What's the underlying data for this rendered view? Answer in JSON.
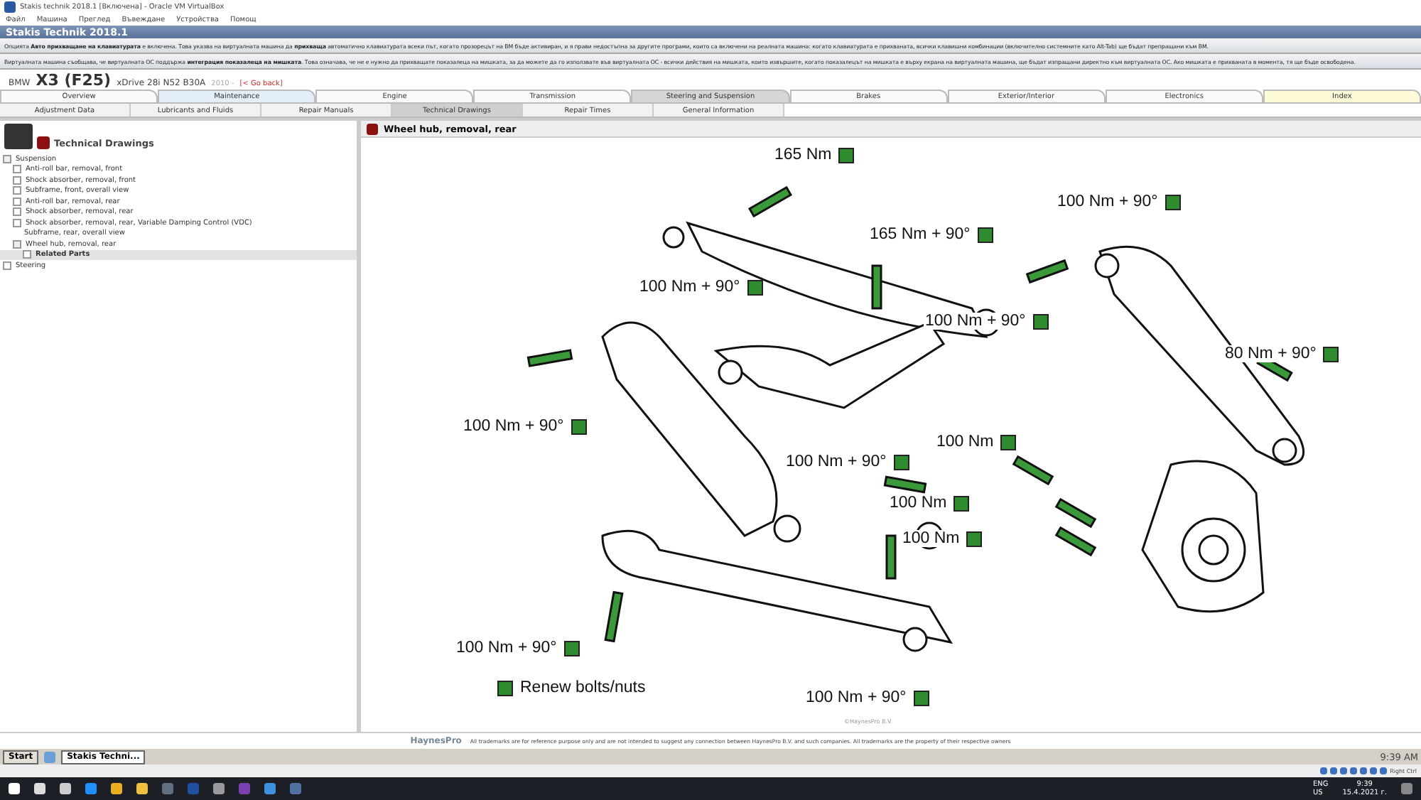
{
  "window": {
    "title": "Stakis technik 2018.1 [Включена] - Oracle VM VirtualBox"
  },
  "menu": [
    "Файл",
    "Машина",
    "Преглед",
    "Въвеждане",
    "Устройства",
    "Помощ"
  ],
  "app_title": "Stakis Technik 2018.1",
  "notices": [
    {
      "text": "Опцията **Авто прихващане на клавиатурата** е включена. Това указва на виртуалната машина да **прихваща** автоматично клавиатурата всеки път, когато прозорецът на ВМ бъде активиран, и я прави недостъпна за другите програми, които са включени на реалната машина: когато клавиатурата е прихваната, всички клавишни комбинации (включително системните като Alt-Tab) ще бъдат препращани към ВМ."
    },
    {
      "text": "Виртуалната машина съобщава, че виртуалната ОС поддържа **интеграция показалеца на мишката**. Това означава, че не е нужно да прихващате показалеца на мишката, за да можете да го използвате във виртуалната ОС - всички действия на мишката, които извършите, когато показалецът на мишката е върху екрана на виртуалната машина, ще бъдат изпращани директно към виртуалната ОС. Ако мишката е прихваната в момента, тя ще бъде освободена."
    }
  ],
  "vehicle": {
    "model": "BMW",
    "name": "X3 (F25)",
    "variant": "xDrive 28i N52 B30A",
    "year": "2010 -",
    "back": "[< Go back]"
  },
  "tabs": [
    {
      "label": "Overview",
      "selected": false,
      "kind": "plain"
    },
    {
      "label": "Maintenance",
      "selected": false,
      "kind": "blue"
    },
    {
      "label": "Engine",
      "selected": false,
      "kind": "plain"
    },
    {
      "label": "Transmission",
      "selected": false,
      "kind": "plain"
    },
    {
      "label": "Steering and Suspension",
      "selected": true,
      "kind": "plain"
    },
    {
      "label": "Brakes",
      "selected": false,
      "kind": "plain"
    },
    {
      "label": "Exterior/Interior",
      "selected": false,
      "kind": "plain"
    },
    {
      "label": "Electronics",
      "selected": false,
      "kind": "plain"
    },
    {
      "label": "Index",
      "selected": false,
      "kind": "yellow"
    }
  ],
  "subtabs": [
    {
      "label": "Adjustment Data",
      "selected": false
    },
    {
      "label": "Lubricants and Fluids",
      "selected": false
    },
    {
      "label": "Repair Manuals",
      "selected": false
    },
    {
      "label": "Technical Drawings",
      "selected": true
    },
    {
      "label": "Repair Times",
      "selected": false
    },
    {
      "label": "General Information",
      "selected": false
    }
  ],
  "sidebar": {
    "title": "Technical Drawings",
    "tree": [
      {
        "label": "Suspension",
        "expanded": true,
        "selected": false,
        "children": [
          {
            "label": "Anti-roll bar, removal, front",
            "expanded": false,
            "selected": false
          },
          {
            "label": "Shock absorber, removal, front",
            "expanded": false,
            "selected": false
          },
          {
            "label": "Subframe, front, overall view",
            "expanded": false,
            "selected": false
          },
          {
            "label": "Anti-roll bar, removal, rear",
            "expanded": false,
            "selected": false
          },
          {
            "label": "Shock absorber, removal, rear",
            "expanded": false,
            "selected": false
          },
          {
            "label": "Shock absorber, removal, rear, Variable Damping Control (VDC)",
            "expanded": false,
            "selected": false
          },
          {
            "label": "Subframe, rear, overall view",
            "selected": false
          },
          {
            "label": "Wheel hub, removal, rear",
            "expanded": true,
            "selected": false,
            "children": [
              {
                "label": "Related Parts",
                "expanded": false,
                "selected": true
              }
            ]
          }
        ]
      },
      {
        "label": "Steering",
        "expanded": false,
        "selected": false
      }
    ]
  },
  "drawing": {
    "title": "Wheel hub, removal, rear",
    "labels": [
      {
        "text": "165 Nm"
      },
      {
        "text": "100 Nm + 90°"
      },
      {
        "text": "165 Nm + 90°"
      },
      {
        "text": "100 Nm + 90°"
      },
      {
        "text": "100 Nm + 90°"
      },
      {
        "text": "80 Nm + 90°"
      },
      {
        "text": "100 Nm + 90°"
      },
      {
        "text": "100 Nm"
      },
      {
        "text": "100 Nm + 90°"
      },
      {
        "text": "100 Nm"
      },
      {
        "text": "100 Nm"
      },
      {
        "text": "100 Nm + 90°"
      },
      {
        "text": "100 Nm + 90°"
      }
    ],
    "legend": "Renew bolts/nuts",
    "copyright": "©HaynesPro B.V."
  },
  "footer": {
    "logo": "HaynesPro",
    "disclaimer": "All trademarks are for reference purpose only and are not intended to suggest any connection between HaynesPro B.V. and such companies. All trademarks are the property of their respective owners"
  },
  "guest_taskbar": {
    "start": "Start",
    "task": "Stakis Techni...",
    "clock": "9:39 AM"
  },
  "host_taskbar": {
    "lang": "ENG",
    "region": "US",
    "time": "9:39",
    "date": "15.4.2021 г."
  },
  "vbox_status": "Right Ctrl"
}
